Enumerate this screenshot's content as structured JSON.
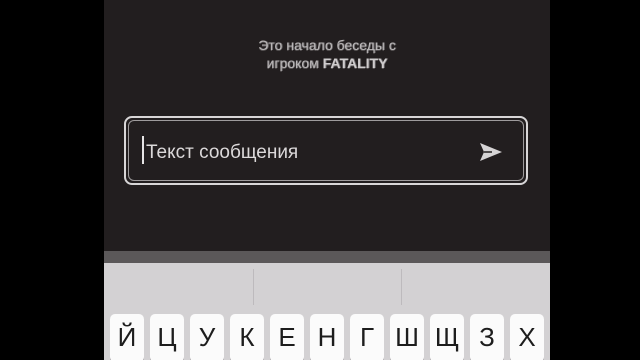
{
  "chat": {
    "start_line1": "Это начало беседы с",
    "start_line2_prefix": "игроком ",
    "player_name": "FATALITY"
  },
  "composer": {
    "placeholder": "Текст сообщения"
  },
  "icons": {
    "send": "send-arrow-icon"
  },
  "keyboard": {
    "top_row": [
      "Й",
      "Ц",
      "У",
      "К",
      "Е",
      "Н",
      "Г",
      "Ш",
      "Щ",
      "З",
      "Х"
    ]
  },
  "colors": {
    "chat_bg": "#221e1f",
    "text": "#b9b6b7",
    "keyboard_bg": "#d3d1d3",
    "key_bg": "#fbfbfb"
  }
}
